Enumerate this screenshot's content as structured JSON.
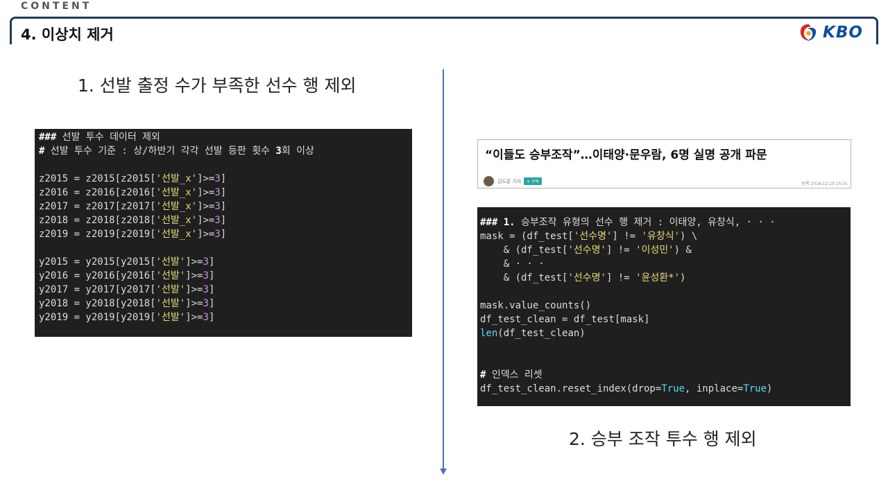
{
  "header": {
    "section_label": "CONTENT",
    "title": "4. 이상치 제거",
    "logo_text": "KBO",
    "logo_icon": "kbo-swirl-icon"
  },
  "left": {
    "heading": "1. 선발 출정 수가 부족한 선수 행 제외",
    "code": [
      [
        {
          "t": "### ",
          "c": "k"
        },
        {
          "t": "선발 투수 데이터 제외",
          "c": "c"
        }
      ],
      [
        {
          "t": "# ",
          "c": "k"
        },
        {
          "t": "선발 투수 기준 : 상/하반기 각각 선발 등판 횟수 ",
          "c": "c"
        },
        {
          "t": "3",
          "c": "k"
        },
        {
          "t": "회 이상",
          "c": "c"
        }
      ],
      [],
      [
        {
          "t": "z2015 = z2015[z2015[",
          "c": "c"
        },
        {
          "t": "'선발_x'",
          "c": "s"
        },
        {
          "t": "]>=",
          "c": "c"
        },
        {
          "t": "3",
          "c": "n"
        },
        {
          "t": "]",
          "c": "c"
        }
      ],
      [
        {
          "t": "z2016 = z2016[z2016[",
          "c": "c"
        },
        {
          "t": "'선발_x'",
          "c": "s"
        },
        {
          "t": "]>=",
          "c": "c"
        },
        {
          "t": "3",
          "c": "n"
        },
        {
          "t": "]",
          "c": "c"
        }
      ],
      [
        {
          "t": "z2017 = z2017[z2017[",
          "c": "c"
        },
        {
          "t": "'선발_x'",
          "c": "s"
        },
        {
          "t": "]>=",
          "c": "c"
        },
        {
          "t": "3",
          "c": "n"
        },
        {
          "t": "]",
          "c": "c"
        }
      ],
      [
        {
          "t": "z2018 = z2018[z2018[",
          "c": "c"
        },
        {
          "t": "'선발_x'",
          "c": "s"
        },
        {
          "t": "]>=",
          "c": "c"
        },
        {
          "t": "3",
          "c": "n"
        },
        {
          "t": "]",
          "c": "c"
        }
      ],
      [
        {
          "t": "z2019 = z2019[z2019[",
          "c": "c"
        },
        {
          "t": "'선발_x'",
          "c": "s"
        },
        {
          "t": "]>=",
          "c": "c"
        },
        {
          "t": "3",
          "c": "n"
        },
        {
          "t": "]",
          "c": "c"
        }
      ],
      [],
      [
        {
          "t": "y2015 = y2015[y2015[",
          "c": "c"
        },
        {
          "t": "'선발'",
          "c": "s"
        },
        {
          "t": "]>=",
          "c": "c"
        },
        {
          "t": "3",
          "c": "n"
        },
        {
          "t": "]",
          "c": "c"
        }
      ],
      [
        {
          "t": "y2016 = y2016[y2016[",
          "c": "c"
        },
        {
          "t": "'선발'",
          "c": "s"
        },
        {
          "t": "]>=",
          "c": "c"
        },
        {
          "t": "3",
          "c": "n"
        },
        {
          "t": "]",
          "c": "c"
        }
      ],
      [
        {
          "t": "y2017 = y2017[y2017[",
          "c": "c"
        },
        {
          "t": "'선발'",
          "c": "s"
        },
        {
          "t": "]>=",
          "c": "c"
        },
        {
          "t": "3",
          "c": "n"
        },
        {
          "t": "]",
          "c": "c"
        }
      ],
      [
        {
          "t": "y2018 = y2018[y2018[",
          "c": "c"
        },
        {
          "t": "'선발'",
          "c": "s"
        },
        {
          "t": "]>=",
          "c": "c"
        },
        {
          "t": "3",
          "c": "n"
        },
        {
          "t": "]",
          "c": "c"
        }
      ],
      [
        {
          "t": "y2019 = y2019[y2019[",
          "c": "c"
        },
        {
          "t": "'선발'",
          "c": "s"
        },
        {
          "t": "]>=",
          "c": "c"
        },
        {
          "t": "3",
          "c": "n"
        },
        {
          "t": "]",
          "c": "c"
        }
      ]
    ]
  },
  "news": {
    "headline": "“이들도 승부조작”…이태양·문우람, 6명 실명 공개 파문",
    "author": "김도훈 기자",
    "subscribe_label": "+ 구독",
    "date": "등록 2018.12.10 15:31"
  },
  "right": {
    "heading": "2. 승부 조작 투수 행 제외",
    "code": [
      [
        {
          "t": "### 1. ",
          "c": "k"
        },
        {
          "t": "승부조작 유형의 선수 행 제거 : 이태양, 유창식, · · ·",
          "c": "c"
        }
      ],
      [
        {
          "t": "mask = (df_test[",
          "c": "c"
        },
        {
          "t": "'선수명'",
          "c": "s"
        },
        {
          "t": "] != ",
          "c": "c"
        },
        {
          "t": "'유창식'",
          "c": "s"
        },
        {
          "t": ") \\",
          "c": "c"
        }
      ],
      [
        {
          "t": "    & (df_test[",
          "c": "c"
        },
        {
          "t": "'선수명'",
          "c": "s"
        },
        {
          "t": "] != ",
          "c": "c"
        },
        {
          "t": "'이성민'",
          "c": "s"
        },
        {
          "t": ") &",
          "c": "c"
        }
      ],
      [
        {
          "t": "    & · · ·",
          "c": "c"
        }
      ],
      [
        {
          "t": "    & (df_test[",
          "c": "c"
        },
        {
          "t": "'선수명'",
          "c": "s"
        },
        {
          "t": "] != ",
          "c": "c"
        },
        {
          "t": "'윤성환*'",
          "c": "s"
        },
        {
          "t": ")",
          "c": "c"
        }
      ],
      [],
      [
        {
          "t": "mask.value_counts()",
          "c": "c"
        }
      ],
      [
        {
          "t": "df_test_clean = df_test[mask]",
          "c": "c"
        }
      ],
      [
        {
          "t": "len",
          "c": "b"
        },
        {
          "t": "(df_test_clean)",
          "c": "c"
        }
      ],
      [],
      [],
      [
        {
          "t": "# ",
          "c": "k"
        },
        {
          "t": "인덱스 리셋",
          "c": "c"
        }
      ],
      [
        {
          "t": "df_test_clean.reset_index(drop=",
          "c": "c"
        },
        {
          "t": "True",
          "c": "b"
        },
        {
          "t": ", inplace=",
          "c": "c"
        },
        {
          "t": "True",
          "c": "b"
        },
        {
          "t": ")",
          "c": "c"
        }
      ]
    ]
  },
  "colors": {
    "header_frame": "#1e3a5f",
    "divider": "#4a73b8",
    "code_bg": "#1f1f1f",
    "string": "#e6db74",
    "number": "#c792ea",
    "builtin": "#5fd7ff",
    "logo_blue": "#0d4ea0",
    "logo_red": "#e2231a"
  }
}
